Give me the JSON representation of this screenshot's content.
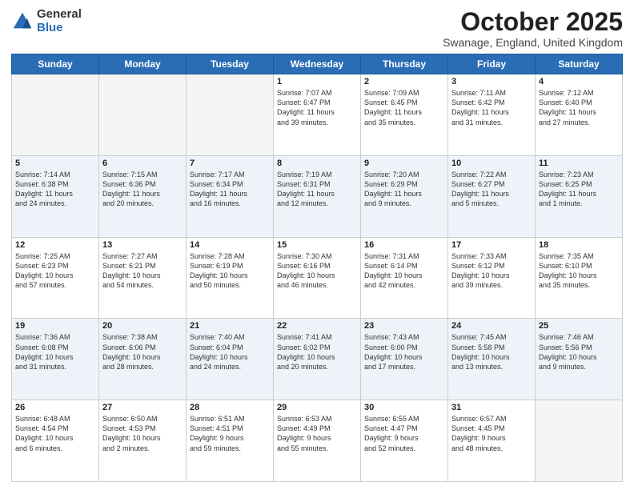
{
  "header": {
    "logo_general": "General",
    "logo_blue": "Blue",
    "month_title": "October 2025",
    "subtitle": "Swanage, England, United Kingdom"
  },
  "weekdays": [
    "Sunday",
    "Monday",
    "Tuesday",
    "Wednesday",
    "Thursday",
    "Friday",
    "Saturday"
  ],
  "weeks": [
    [
      {
        "day": "",
        "lines": []
      },
      {
        "day": "",
        "lines": []
      },
      {
        "day": "",
        "lines": []
      },
      {
        "day": "1",
        "lines": [
          "Sunrise: 7:07 AM",
          "Sunset: 6:47 PM",
          "Daylight: 11 hours",
          "and 39 minutes."
        ]
      },
      {
        "day": "2",
        "lines": [
          "Sunrise: 7:09 AM",
          "Sunset: 6:45 PM",
          "Daylight: 11 hours",
          "and 35 minutes."
        ]
      },
      {
        "day": "3",
        "lines": [
          "Sunrise: 7:11 AM",
          "Sunset: 6:42 PM",
          "Daylight: 11 hours",
          "and 31 minutes."
        ]
      },
      {
        "day": "4",
        "lines": [
          "Sunrise: 7:12 AM",
          "Sunset: 6:40 PM",
          "Daylight: 11 hours",
          "and 27 minutes."
        ]
      }
    ],
    [
      {
        "day": "5",
        "lines": [
          "Sunrise: 7:14 AM",
          "Sunset: 6:38 PM",
          "Daylight: 11 hours",
          "and 24 minutes."
        ]
      },
      {
        "day": "6",
        "lines": [
          "Sunrise: 7:15 AM",
          "Sunset: 6:36 PM",
          "Daylight: 11 hours",
          "and 20 minutes."
        ]
      },
      {
        "day": "7",
        "lines": [
          "Sunrise: 7:17 AM",
          "Sunset: 6:34 PM",
          "Daylight: 11 hours",
          "and 16 minutes."
        ]
      },
      {
        "day": "8",
        "lines": [
          "Sunrise: 7:19 AM",
          "Sunset: 6:31 PM",
          "Daylight: 11 hours",
          "and 12 minutes."
        ]
      },
      {
        "day": "9",
        "lines": [
          "Sunrise: 7:20 AM",
          "Sunset: 6:29 PM",
          "Daylight: 11 hours",
          "and 9 minutes."
        ]
      },
      {
        "day": "10",
        "lines": [
          "Sunrise: 7:22 AM",
          "Sunset: 6:27 PM",
          "Daylight: 11 hours",
          "and 5 minutes."
        ]
      },
      {
        "day": "11",
        "lines": [
          "Sunrise: 7:23 AM",
          "Sunset: 6:25 PM",
          "Daylight: 11 hours",
          "and 1 minute."
        ]
      }
    ],
    [
      {
        "day": "12",
        "lines": [
          "Sunrise: 7:25 AM",
          "Sunset: 6:23 PM",
          "Daylight: 10 hours",
          "and 57 minutes."
        ]
      },
      {
        "day": "13",
        "lines": [
          "Sunrise: 7:27 AM",
          "Sunset: 6:21 PM",
          "Daylight: 10 hours",
          "and 54 minutes."
        ]
      },
      {
        "day": "14",
        "lines": [
          "Sunrise: 7:28 AM",
          "Sunset: 6:19 PM",
          "Daylight: 10 hours",
          "and 50 minutes."
        ]
      },
      {
        "day": "15",
        "lines": [
          "Sunrise: 7:30 AM",
          "Sunset: 6:16 PM",
          "Daylight: 10 hours",
          "and 46 minutes."
        ]
      },
      {
        "day": "16",
        "lines": [
          "Sunrise: 7:31 AM",
          "Sunset: 6:14 PM",
          "Daylight: 10 hours",
          "and 42 minutes."
        ]
      },
      {
        "day": "17",
        "lines": [
          "Sunrise: 7:33 AM",
          "Sunset: 6:12 PM",
          "Daylight: 10 hours",
          "and 39 minutes."
        ]
      },
      {
        "day": "18",
        "lines": [
          "Sunrise: 7:35 AM",
          "Sunset: 6:10 PM",
          "Daylight: 10 hours",
          "and 35 minutes."
        ]
      }
    ],
    [
      {
        "day": "19",
        "lines": [
          "Sunrise: 7:36 AM",
          "Sunset: 6:08 PM",
          "Daylight: 10 hours",
          "and 31 minutes."
        ]
      },
      {
        "day": "20",
        "lines": [
          "Sunrise: 7:38 AM",
          "Sunset: 6:06 PM",
          "Daylight: 10 hours",
          "and 28 minutes."
        ]
      },
      {
        "day": "21",
        "lines": [
          "Sunrise: 7:40 AM",
          "Sunset: 6:04 PM",
          "Daylight: 10 hours",
          "and 24 minutes."
        ]
      },
      {
        "day": "22",
        "lines": [
          "Sunrise: 7:41 AM",
          "Sunset: 6:02 PM",
          "Daylight: 10 hours",
          "and 20 minutes."
        ]
      },
      {
        "day": "23",
        "lines": [
          "Sunrise: 7:43 AM",
          "Sunset: 6:00 PM",
          "Daylight: 10 hours",
          "and 17 minutes."
        ]
      },
      {
        "day": "24",
        "lines": [
          "Sunrise: 7:45 AM",
          "Sunset: 5:58 PM",
          "Daylight: 10 hours",
          "and 13 minutes."
        ]
      },
      {
        "day": "25",
        "lines": [
          "Sunrise: 7:46 AM",
          "Sunset: 5:56 PM",
          "Daylight: 10 hours",
          "and 9 minutes."
        ]
      }
    ],
    [
      {
        "day": "26",
        "lines": [
          "Sunrise: 6:48 AM",
          "Sunset: 4:54 PM",
          "Daylight: 10 hours",
          "and 6 minutes."
        ]
      },
      {
        "day": "27",
        "lines": [
          "Sunrise: 6:50 AM",
          "Sunset: 4:53 PM",
          "Daylight: 10 hours",
          "and 2 minutes."
        ]
      },
      {
        "day": "28",
        "lines": [
          "Sunrise: 6:51 AM",
          "Sunset: 4:51 PM",
          "Daylight: 9 hours",
          "and 59 minutes."
        ]
      },
      {
        "day": "29",
        "lines": [
          "Sunrise: 6:53 AM",
          "Sunset: 4:49 PM",
          "Daylight: 9 hours",
          "and 55 minutes."
        ]
      },
      {
        "day": "30",
        "lines": [
          "Sunrise: 6:55 AM",
          "Sunset: 4:47 PM",
          "Daylight: 9 hours",
          "and 52 minutes."
        ]
      },
      {
        "day": "31",
        "lines": [
          "Sunrise: 6:57 AM",
          "Sunset: 4:45 PM",
          "Daylight: 9 hours",
          "and 48 minutes."
        ]
      },
      {
        "day": "",
        "lines": []
      }
    ]
  ]
}
